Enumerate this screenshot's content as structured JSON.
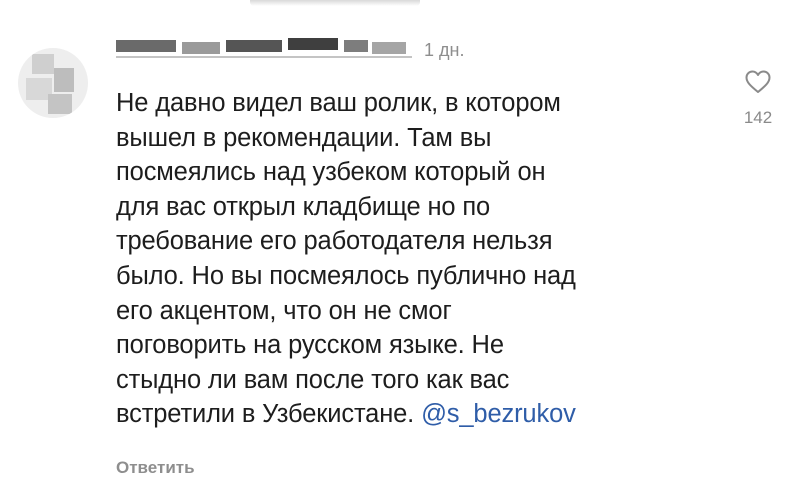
{
  "comment": {
    "username_redacted": true,
    "time": "1 дн.",
    "text_lines": [
      "Не давно видел ваш ролик, в котором",
      "вышел в рекомендации. Там вы",
      "посмеялись над узбеком который он",
      "для вас открыл кладбище но по",
      "требование его работодателя нельзя",
      "было. Но вы посмеялось публично над",
      "его акцентом, что он не смог",
      "поговорить на русском языке. Не",
      "стыдно ли вам после того как вас"
    ],
    "last_line_text": "встретили в Узбекистане. ",
    "mention": "@s_bezrukov",
    "like_icon": "heart-outline-icon",
    "like_count": "142",
    "reply_label": "Ответить"
  },
  "colors": {
    "mention": "#2f5da8",
    "muted": "#8e8e8e",
    "text": "#1d1d1d"
  }
}
